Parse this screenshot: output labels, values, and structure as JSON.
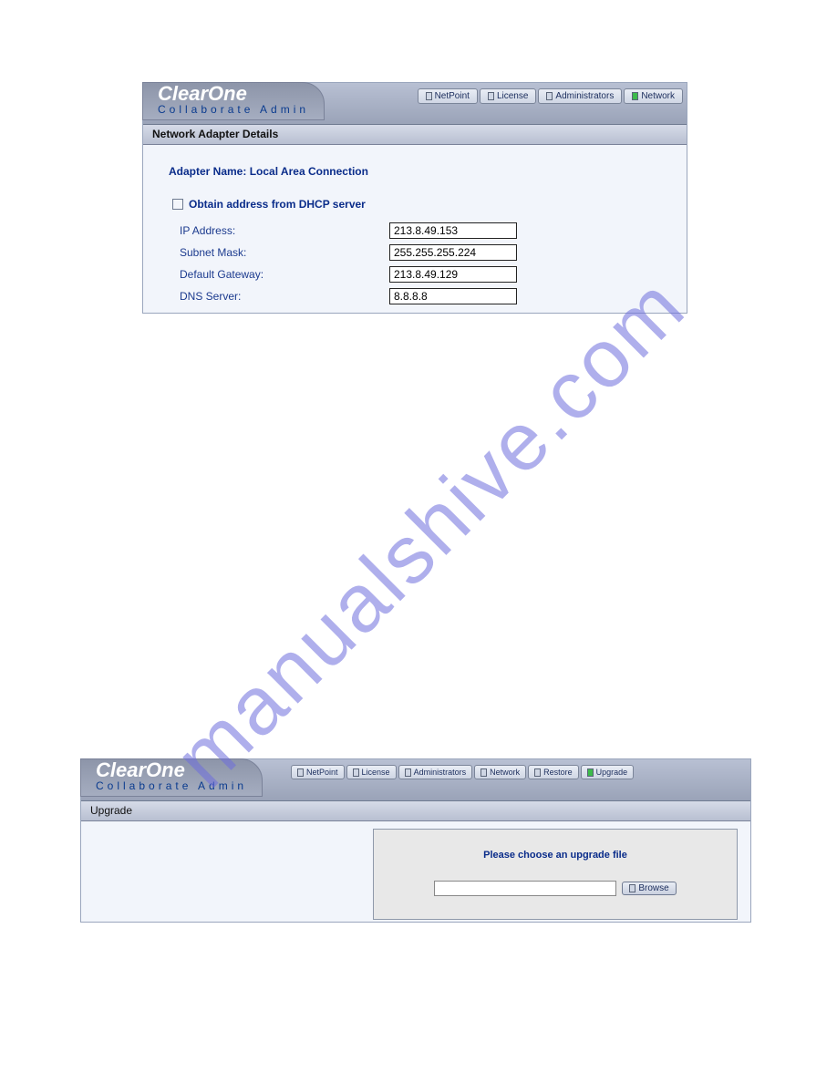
{
  "brand": {
    "logo": "ClearOne",
    "subtitle": "Collaborate Admin"
  },
  "panel1": {
    "tabs": [
      {
        "label": "NetPoint",
        "active": false
      },
      {
        "label": "License",
        "active": false
      },
      {
        "label": "Administrators",
        "active": false
      },
      {
        "label": "Network",
        "active": true
      }
    ],
    "title": "Network Adapter Details",
    "adapter_name_label": "Adapter Name:",
    "adapter_name_value": "Local Area Connection",
    "dhcp_label": "Obtain address from DHCP server",
    "fields": {
      "ip_label": "IP Address:",
      "ip_value": "213.8.49.153",
      "mask_label": "Subnet Mask:",
      "mask_value": "255.255.255.224",
      "gw_label": "Default Gateway:",
      "gw_value": "213.8.49.129",
      "dns_label": "DNS Server:",
      "dns_value": "8.8.8.8"
    }
  },
  "panel2": {
    "tabs": [
      {
        "label": "NetPoint",
        "active": false
      },
      {
        "label": "License",
        "active": false
      },
      {
        "label": "Administrators",
        "active": false
      },
      {
        "label": "Network",
        "active": false
      },
      {
        "label": "Restore",
        "active": false
      },
      {
        "label": "Upgrade",
        "active": true
      }
    ],
    "title": "Upgrade",
    "message": "Please choose an upgrade file",
    "browse_label": "Browse",
    "file_value": ""
  },
  "watermark": "manualshive.com"
}
